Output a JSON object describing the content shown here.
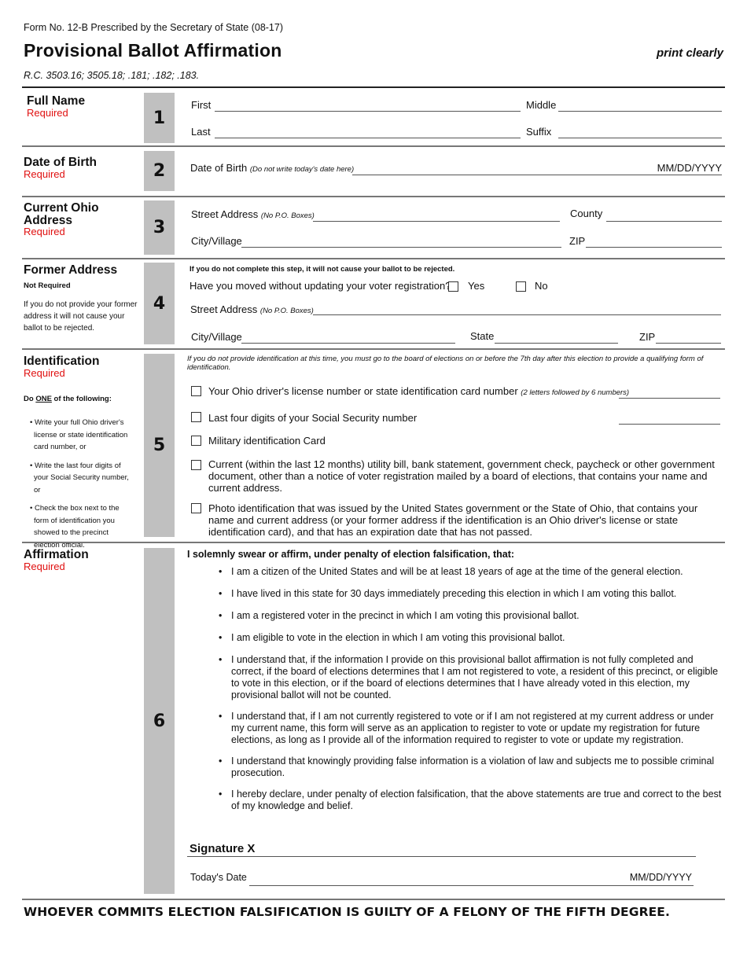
{
  "header": {
    "form_number": "Form No. 12-B Prescribed by the Secretary of State (08-17)",
    "title": "Provisional Ballot Affirmation",
    "print_note": "print clearly",
    "statute": "R.C. 3503.16; 3505.18; .181; .182; .183."
  },
  "required_label": "Required",
  "sections": {
    "full_name": {
      "number": "1",
      "title": "Full Name",
      "status": "Required",
      "fields": {
        "first": "First",
        "middle": "Middle",
        "last": "Last",
        "suffix": "Suffix"
      }
    },
    "dob": {
      "number": "2",
      "title": "Date of Birth",
      "status": "Required",
      "label": "Date of Birth",
      "note": "(Do not write today's date here)",
      "format": "MM/DD/YYYY"
    },
    "current_address": {
      "number": "3",
      "title_line1": "Current Ohio",
      "title_line2": "Address",
      "status": "Required",
      "street_label": "Street Address",
      "street_note": "(No P.O. Boxes)",
      "county_label": "County",
      "city_label": "City/Village",
      "zip_label": "ZIP"
    },
    "former_address": {
      "number": "4",
      "title": "Former Address",
      "status": "Not Required",
      "side_note": "If you do not provide your former address it will not cause your ballot to be rejected.",
      "top_note": "If you do not complete this step, it will not cause your ballot to be rejected.",
      "question": "Have you moved without updating your voter registration?",
      "yes_label": "Yes",
      "no_label": "No",
      "street_label": "Street Address",
      "street_note": "(No P.O. Boxes)",
      "city_label": "City/Village",
      "state_label": "State",
      "zip_label": "ZIP"
    },
    "identification": {
      "number": "5",
      "title": "Identification",
      "status": "Required",
      "instruction_prefix": "Do ",
      "instruction_emph": "ONE",
      "instruction_suffix": " of the following:",
      "side_bullets": [
        "Write your full Ohio driver's license or state identification card number, or",
        "Write the last four digits of your Social Security number, or",
        "Check the box next to the form of identification you showed to the precinct election official."
      ],
      "top_note": "If you do not provide identification at this time, you must go to the board of elections on or before the 7th day after this election to provide a qualifying form of identification.",
      "options": [
        {
          "label": "Your Ohio driver's license number or state identification card number",
          "note": "(2 letters followed by 6 numbers)"
        },
        {
          "label": "Last four digits of your Social Security number",
          "note": ""
        },
        {
          "label": "Military identification Card",
          "note": ""
        },
        {
          "label": "Current (within the last 12 months) utility bill, bank statement, government check, paycheck or other government document, other than a notice of voter registration mailed by a board of elections, that contains your name and current address.",
          "note": ""
        },
        {
          "label": "Photo identification that was issued by the United States government or the State of Ohio, that contains your name and current address (or your former address if the identification is an Ohio driver's license or state identification card), and that has an expiration date that has not passed.",
          "note": ""
        }
      ]
    },
    "affirmation": {
      "number": "6",
      "title": "Affirmation",
      "status": "Required",
      "intro": "I solemnly swear or affirm, under penalty of election falsification, that:",
      "statements": [
        "I am a citizen of the United States and will be at least 18 years of age at the time of the general election.",
        "I have lived in this state for 30 days immediately preceding this election in which I am voting this ballot.",
        "I am a registered voter in the precinct in which I am voting this provisional ballot.",
        "I am eligible to vote in the election in which I am voting this provisional ballot.",
        "I understand that, if the information I provide on this provisional ballot affirmation is not fully completed and correct, if the board of elections determines that I am not registered to vote, a resident of this precinct, or eligible to vote in this election, or if the board of elections determines that I have already voted in this election, my provisional ballot will not be counted.",
        "I understand that, if I am not currently registered to vote or if I am not registered at my current address or under my current name, this form will serve as an application to register to vote or update my registration for future elections, as long as I provide all of the information required to register to vote or update my registration.",
        "I understand that knowingly providing false information is a violation of law and subjects me to possible criminal prosecution.",
        "I hereby declare, under penalty of election falsification, that the above statements are true and correct to the best of my knowledge and belief."
      ],
      "signature_label": "Signature X",
      "date_label": "Today's Date",
      "date_format": "MM/DD/YYYY"
    }
  },
  "footer_warning": "WHOEVER COMMITS ELECTION FALSIFICATION IS GUILTY OF A FELONY OF THE FIFTH DEGREE."
}
